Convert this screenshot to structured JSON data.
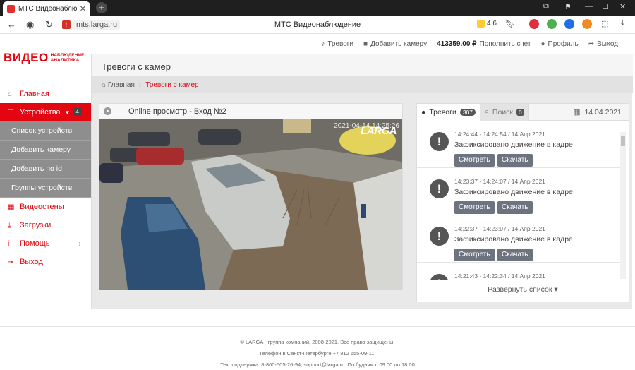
{
  "browser": {
    "tab_title": "МТС Видеонаблюдение",
    "tab_close": "✕",
    "new_tab": "+",
    "url": "mts.larga.ru",
    "page_title": "МТС Видеонаблюдение",
    "rating": "4.6"
  },
  "topbar": {
    "alerts": "Тревоги",
    "add_camera": "Добавить камеру",
    "balance": "413359.00 ₽",
    "topup": "Пополнить счет",
    "profile": "Профиль",
    "logout": "Выход"
  },
  "logo": {
    "main": "ВИДЕО",
    "sub1": "НАБЛЮДЕНИЕ",
    "sub2": "АНАЛИТИКА"
  },
  "sidebar": {
    "items": [
      {
        "label": "Главная"
      },
      {
        "label": "Устройства",
        "badge": "4"
      },
      {
        "label": "Видеостены"
      },
      {
        "label": "Загрузки"
      },
      {
        "label": "Помощь"
      },
      {
        "label": "Выход"
      }
    ],
    "subitems": [
      {
        "label": "Список устройств"
      },
      {
        "label": "Добавить камеру"
      },
      {
        "label": "Добавить по id"
      },
      {
        "label": "Группы устройств"
      }
    ]
  },
  "page": {
    "title": "Тревоги с камер",
    "breadcrumb_home": "Главная",
    "breadcrumb_current": "Тревоги с камер"
  },
  "video": {
    "title": "Online просмотр - Вход №2",
    "timestamp": "2021-04-14 14:25:26",
    "brand": "LARGA"
  },
  "alerts": {
    "tab_label": "Тревоги",
    "count": "307",
    "search_label": "Поиск",
    "search_count": "0",
    "date": "14.04.2021",
    "view_label": "Смотреть",
    "download_label": "Скачать",
    "expand_label": "Развернуть список",
    "items": [
      {
        "time": "14:24:44 - 14:24:54 / 14 Апр 2021",
        "text": "Зафиксировано движение в кадре"
      },
      {
        "time": "14:23:37 - 14:24:07 / 14 Апр 2021",
        "text": "Зафиксировано движение в кадре"
      },
      {
        "time": "14:22:37 - 14:23:07 / 14 Апр 2021",
        "text": "Зафиксировано движение в кадре"
      },
      {
        "time": "14:21:43 - 14:22:34 / 14 Апр 2021",
        "text": ""
      }
    ]
  },
  "footer": {
    "line1": "© LARGA - группа компаний, 2008-2021. Все права защищены.",
    "line2": "Телефон в Санкт-Петербурге +7 812 655-09-11.",
    "line3": "Тех. поддержка: 8-800-505-26-94, support@larga.ru. По будням с 09:00 до 18:00"
  }
}
